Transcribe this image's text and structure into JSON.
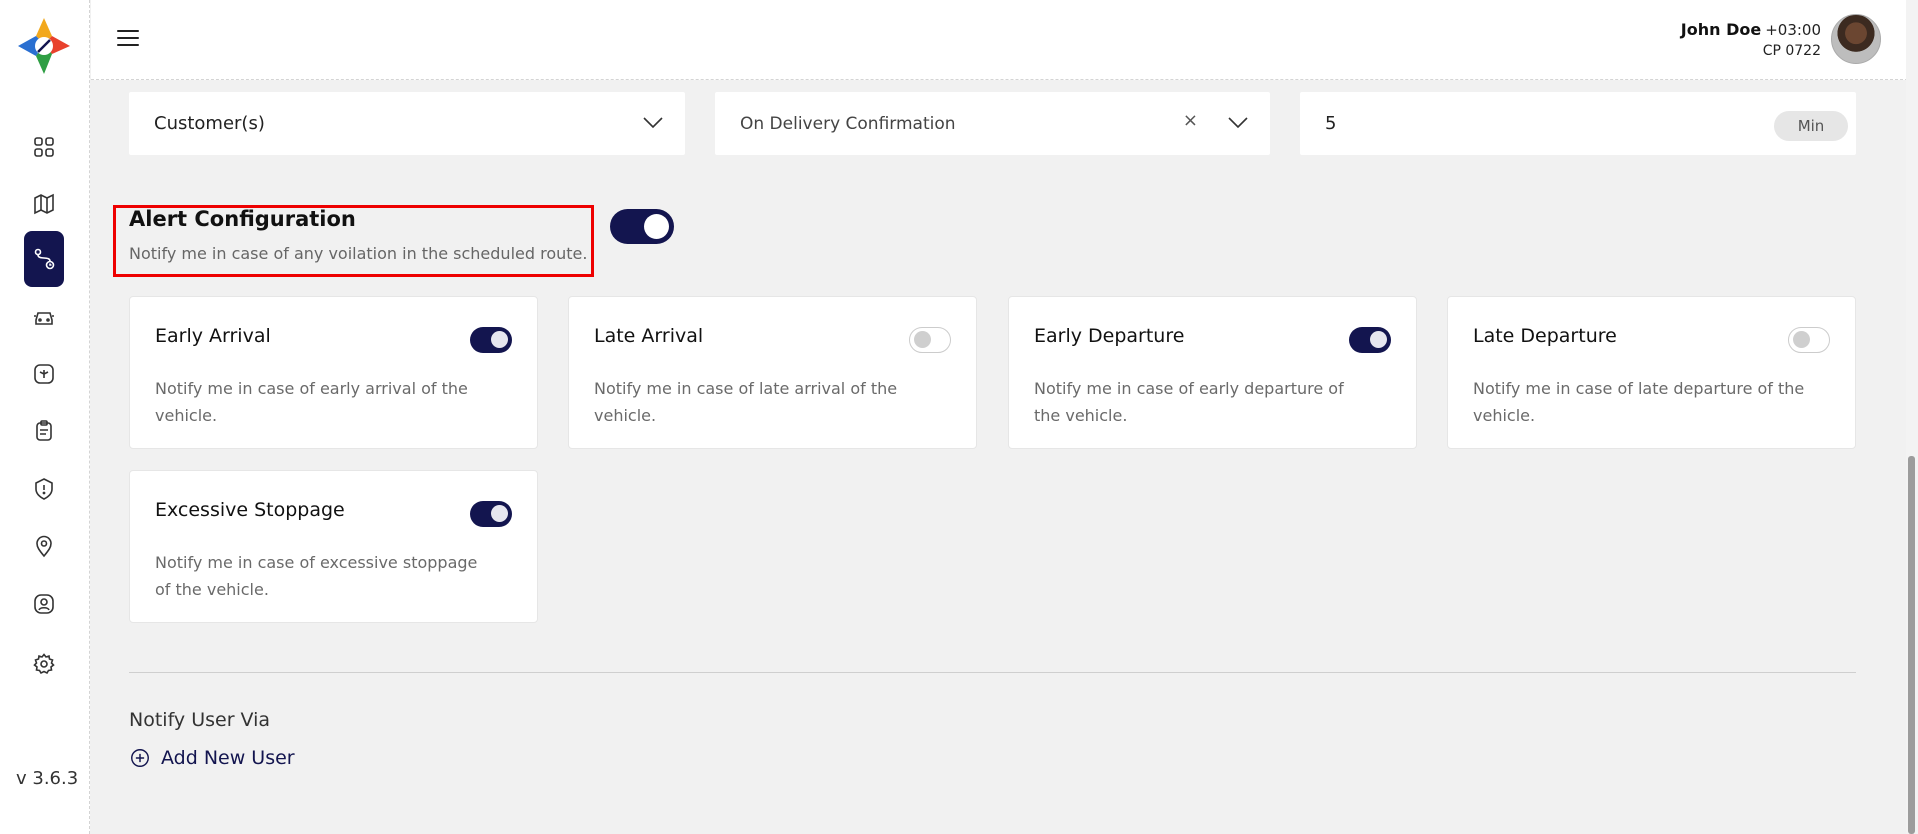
{
  "sidebar": {
    "version": "v 3.6.3",
    "items": [
      {
        "name": "dashboard-icon"
      },
      {
        "name": "map-icon"
      },
      {
        "name": "route-icon",
        "active": true
      },
      {
        "name": "car-icon"
      },
      {
        "name": "steering-wheel-icon"
      },
      {
        "name": "clipboard-icon"
      },
      {
        "name": "alert-shield-icon"
      },
      {
        "name": "location-pin-icon"
      },
      {
        "name": "user-profile-icon"
      },
      {
        "name": "settings-gear-icon"
      }
    ]
  },
  "header": {
    "user_name": "John Doe",
    "timezone": "+03:00",
    "user_id": "CP 0722"
  },
  "filters": {
    "recipient": "Customer(s)",
    "trigger": "On Delivery Confirmation",
    "duration_value": "5",
    "duration_unit": "Min"
  },
  "alert": {
    "title": "Alert Configuration",
    "subtitle": "Notify me in case of any voilation in the scheduled route.",
    "enabled": true
  },
  "cards": [
    {
      "title": "Early Arrival",
      "desc": "Notify me in case of early arrival of the vehicle.",
      "on": true
    },
    {
      "title": "Late Arrival",
      "desc": "Notify me in case of late arrival of the vehicle.",
      "on": false
    },
    {
      "title": "Early Departure",
      "desc": "Notify me in case of early departure of the vehicle.",
      "on": true
    },
    {
      "title": "Late Departure",
      "desc": "Notify me in case of late departure of the vehicle.",
      "on": false
    },
    {
      "title": "Excessive Stoppage",
      "desc": "Notify me in case of excessive stoppage of the vehicle.",
      "on": true
    }
  ],
  "notify": {
    "label": "Notify User Via",
    "add_user": "Add New User"
  },
  "colors": {
    "primary": "#13154f",
    "highlight": "#ee0000",
    "background": "#f1f1f1"
  }
}
